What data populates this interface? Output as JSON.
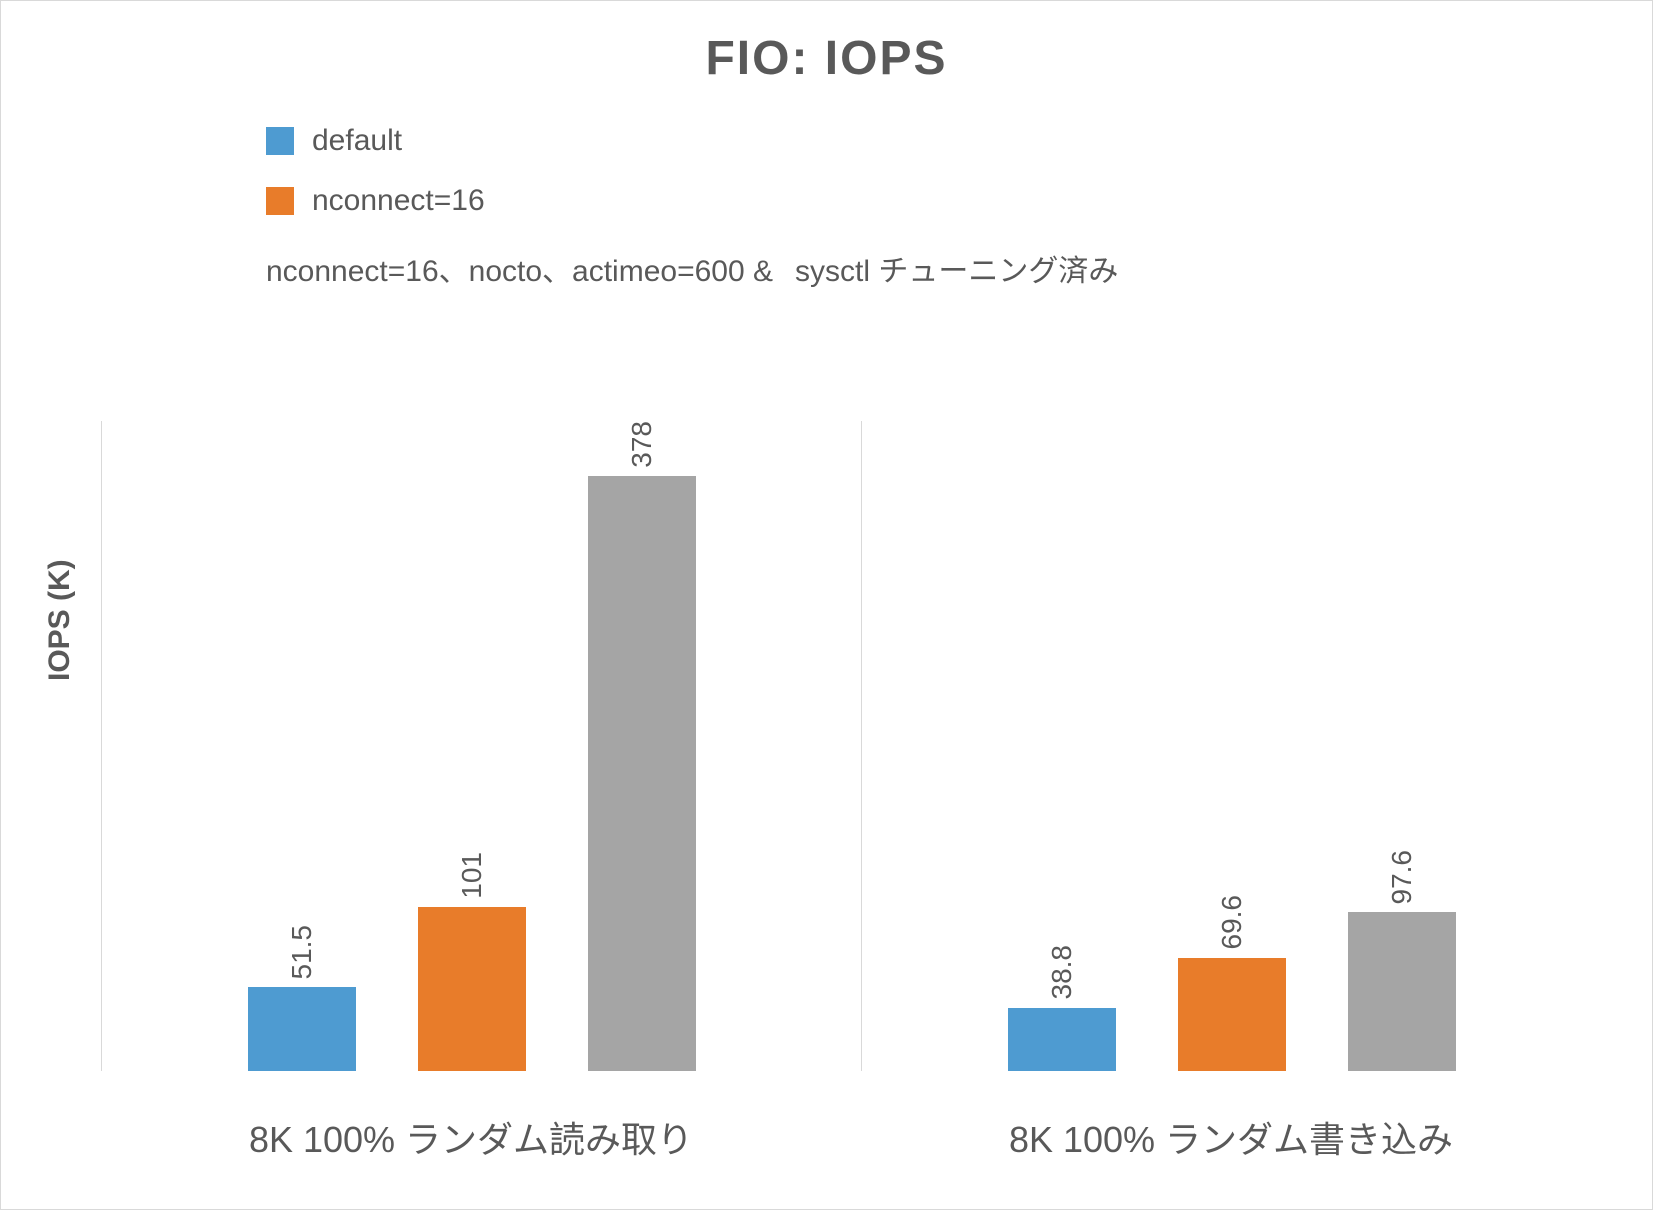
{
  "chart_data": {
    "type": "bar",
    "title": "FIO: IOPS",
    "ylabel": "IOPS (K)",
    "xlabel": "",
    "ylim": [
      0,
      400
    ],
    "categories": [
      "8K 100% ランダム読み取り",
      "8K 100% ランダム書き込み"
    ],
    "series": [
      {
        "name": "default",
        "color": "#4e9bd1",
        "values": [
          51.5,
          38.8
        ]
      },
      {
        "name": "nconnect=16",
        "color": "#e87c2a",
        "values": [
          101,
          69.6
        ]
      },
      {
        "name": "nconnect=16、nocto、actimeo=600 & sysctl チューニング済み",
        "color": "#a5a5a5",
        "values": [
          378,
          97.6
        ]
      }
    ],
    "legend_display": {
      "row1": "default",
      "row2": "nconnect=16",
      "row3_left": "nconnect=16、nocto、actimeo=600 &",
      "row3_right": "sysctl チューニング済み"
    }
  }
}
